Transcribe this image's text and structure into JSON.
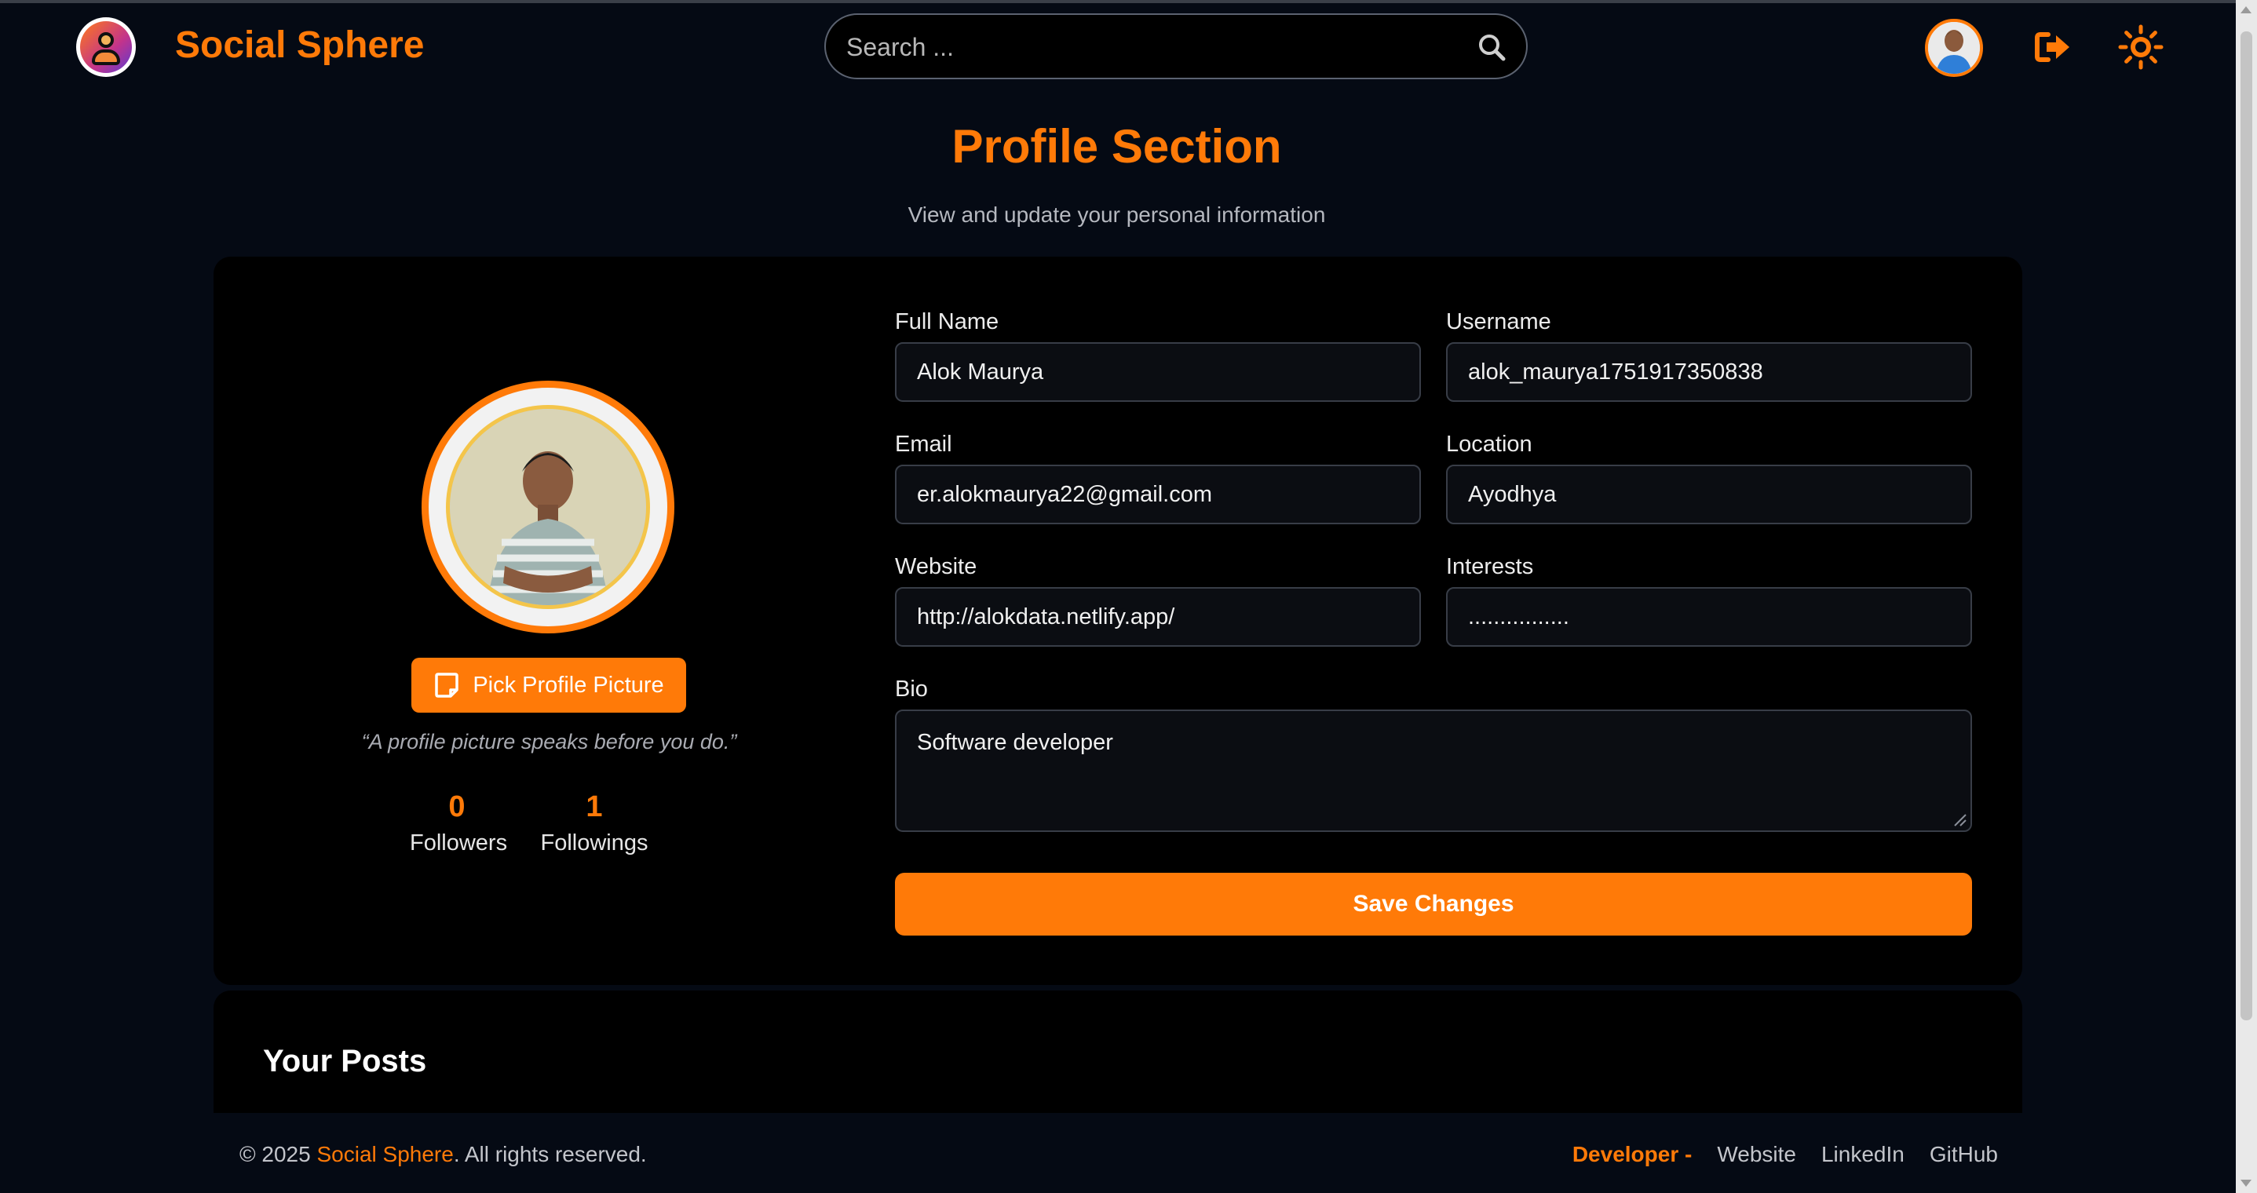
{
  "header": {
    "brand": "Social Sphere",
    "search_placeholder": "Search ...",
    "icons": [
      "search-icon",
      "logout-icon",
      "theme-toggle-icon"
    ]
  },
  "page": {
    "title": "Profile Section",
    "subtitle": "View and update your personal information"
  },
  "profile": {
    "pick_button": "Pick Profile Picture",
    "quote": "“A profile picture speaks before you do.”",
    "followers_count": "0",
    "followers_label": "Followers",
    "followings_count": "1",
    "followings_label": "Followings"
  },
  "form": {
    "full_name": {
      "label": "Full Name",
      "value": "Alok Maurya"
    },
    "username": {
      "label": "Username",
      "value": "alok_maurya1751917350838"
    },
    "email": {
      "label": "Email",
      "value": "er.alokmaurya22@gmail.com"
    },
    "location": {
      "label": "Location",
      "value": "Ayodhya"
    },
    "website": {
      "label": "Website",
      "value": "http://alokdata.netlify.app/"
    },
    "interests": {
      "label": "Interests",
      "value": "................"
    },
    "bio": {
      "label": "Bio",
      "value": "Software developer"
    },
    "save_button": "Save Changes"
  },
  "posts": {
    "title": "Your Posts"
  },
  "footer": {
    "copyright_prefix": "© 2025 ",
    "brand": "Social Sphere",
    "copyright_suffix": ". All rights reserved.",
    "developer_label": "Developer -",
    "links": [
      "Website",
      "LinkedIn",
      "GitHub"
    ]
  },
  "colors": {
    "accent": "#ff7a08",
    "background": "#050a14",
    "card": "#000000"
  }
}
